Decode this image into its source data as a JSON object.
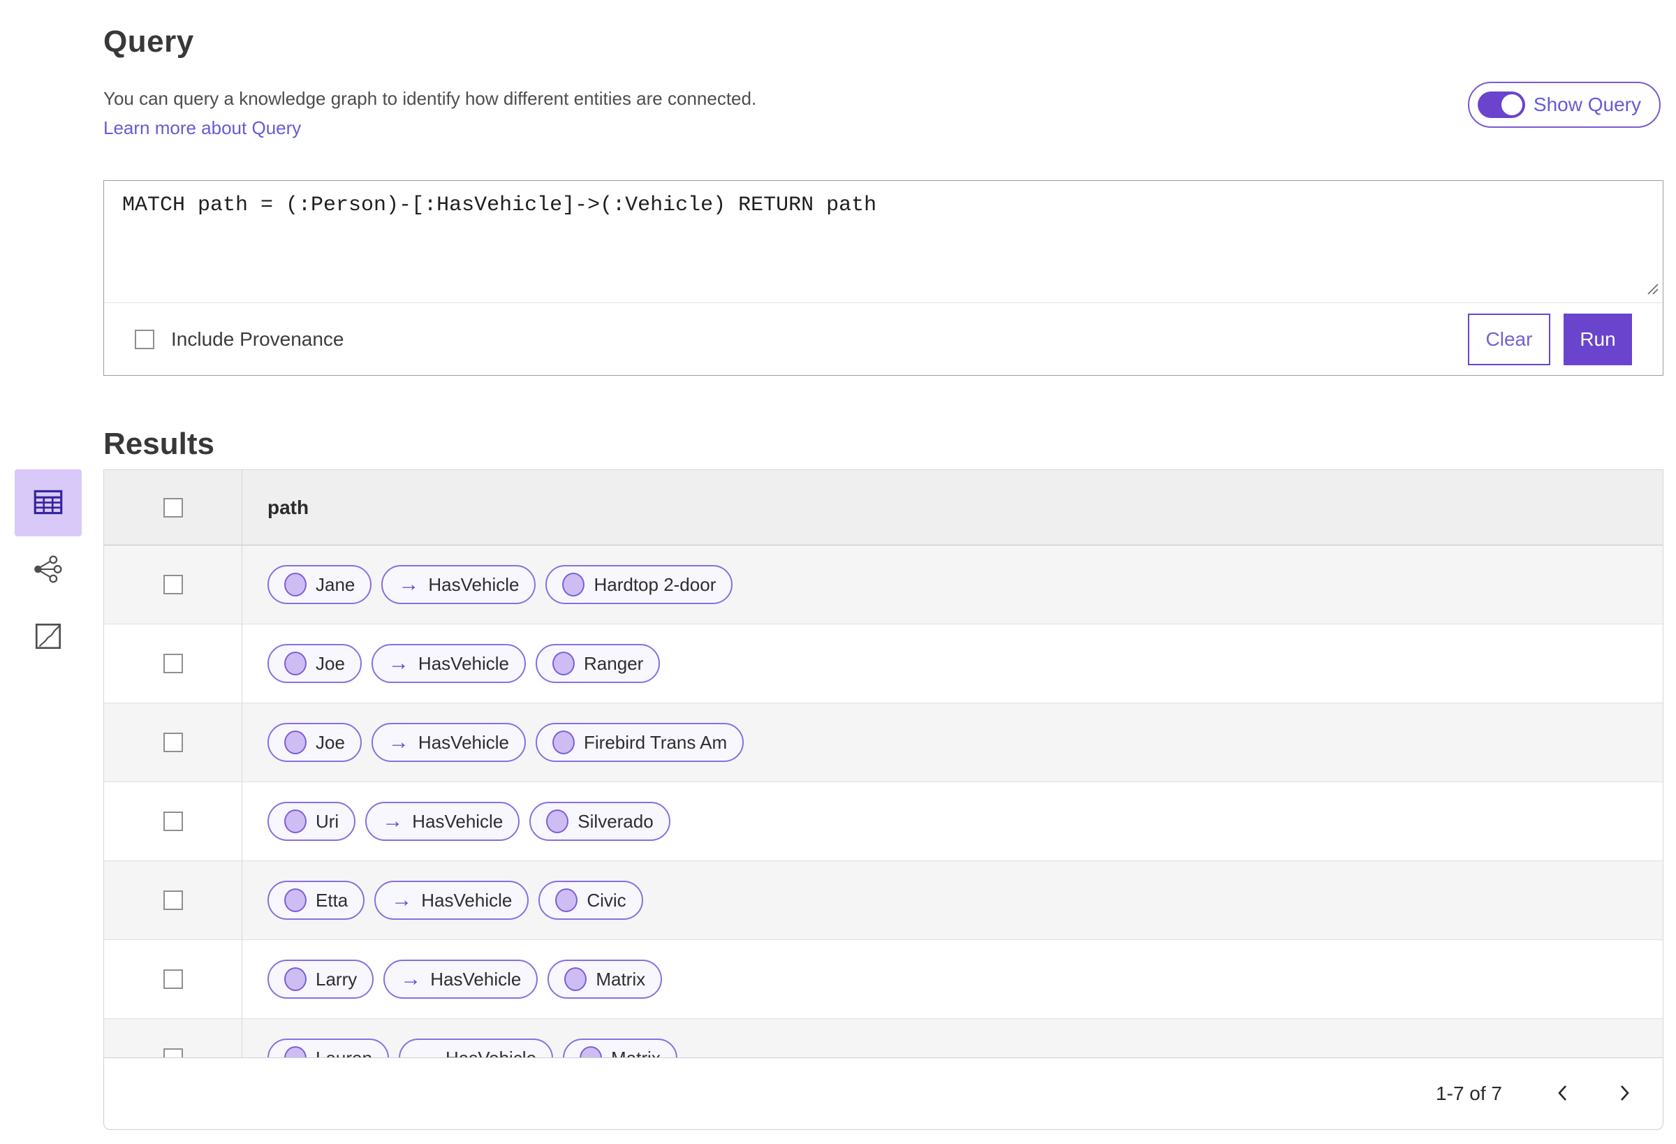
{
  "header": {
    "title": "Query",
    "description": "You can query a knowledge graph to identify how different entities are connected.",
    "learn_more_link": "Learn more about Query"
  },
  "show_query_toggle": {
    "label": "Show Query",
    "state_on": true
  },
  "query_editor": {
    "query_text": "MATCH path = (:Person)-[:HasVehicle]->(:Vehicle) RETURN path",
    "include_provenance_label": "Include Provenance",
    "include_provenance_checked": false,
    "clear_button_label": "Clear",
    "run_button_label": "Run"
  },
  "results": {
    "title": "Results",
    "column_header": "path",
    "select_all_checked": false,
    "rows": [
      {
        "source": "Jane",
        "relationship": "HasVehicle",
        "target": "Hardtop 2-door"
      },
      {
        "source": "Joe",
        "relationship": "HasVehicle",
        "target": "Ranger"
      },
      {
        "source": "Joe",
        "relationship": "HasVehicle",
        "target": "Firebird Trans Am"
      },
      {
        "source": "Uri",
        "relationship": "HasVehicle",
        "target": "Silverado"
      },
      {
        "source": "Etta",
        "relationship": "HasVehicle",
        "target": "Civic"
      },
      {
        "source": "Larry",
        "relationship": "HasVehicle",
        "target": "Matrix"
      },
      {
        "source": "Lauren",
        "relationship": "HasVehicle",
        "target": "Matrix"
      }
    ],
    "pagination": {
      "range_label": "1-7 of 7"
    }
  },
  "view_switcher": {
    "items": [
      {
        "name": "table-view",
        "icon": "table-icon",
        "selected": true
      },
      {
        "name": "link-chart-view",
        "icon": "link-chart-icon",
        "selected": false
      },
      {
        "name": "map-view",
        "icon": "map-icon",
        "selected": false
      }
    ]
  },
  "icons": {
    "relationship_arrow": "→"
  },
  "colors": {
    "accent_purple": "#6a44cd",
    "accent_light_bg": "#d9c9f8",
    "chip_border": "#8a6fe0",
    "chip_bg": "#f8f7fe",
    "chip_node_fill": "#cebdf3",
    "chip_node_border": "#7d5fd6",
    "link_text": "#655bd4",
    "header_row_bg": "#efeff0",
    "alt_row_bg": "#f5f5f6"
  }
}
